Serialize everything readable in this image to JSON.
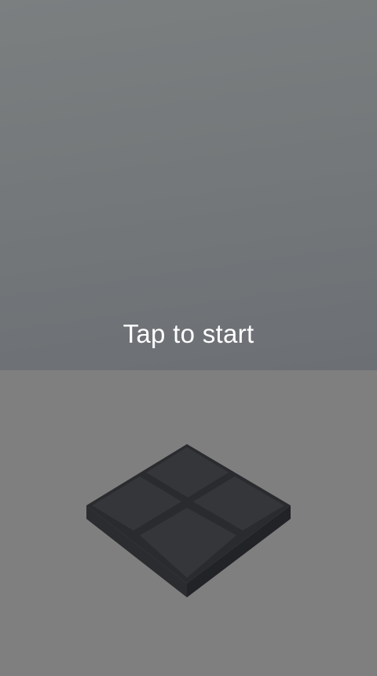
{
  "start_screen": {
    "prompt": "Tap to start"
  },
  "colors": {
    "sky_top": "#7b7f80",
    "sky_bottom": "#6c7075",
    "ground": "#7f7f7f",
    "tile_top": "#34363a",
    "tile_grout": "#2a2b2e",
    "tile_side_left": "#2b2c2f",
    "tile_side_right": "#222326",
    "prompt_text": "#ffffff"
  },
  "board": {
    "rows": 2,
    "columns": 2
  }
}
